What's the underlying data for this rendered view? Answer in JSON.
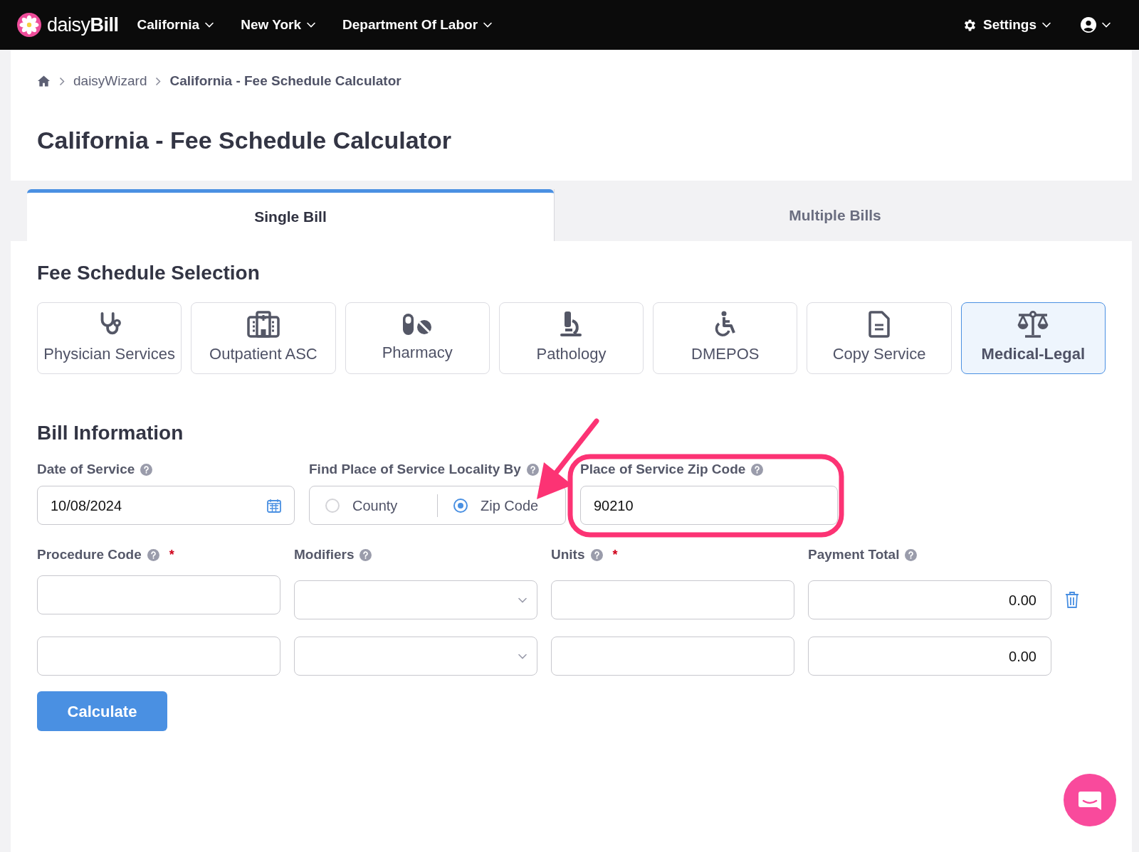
{
  "nav": {
    "logo": "daisy**Bill**",
    "menus": [
      "California",
      "New York",
      "Department Of Labor"
    ],
    "settings": "Settings"
  },
  "breadcrumb": [
    "daisyWizard",
    "California - Fee Schedule Calculator"
  ],
  "title": "California - Fee Schedule Calculator",
  "tabs": [
    {
      "label": "Single Bill",
      "selected": true
    },
    {
      "label": "Multiple Bills",
      "selected": false
    }
  ],
  "fee_schedule": {
    "heading": "Fee Schedule Selection",
    "options": [
      {
        "label": "Physician Services",
        "selected": false
      },
      {
        "label": "Outpatient ASC",
        "selected": false
      },
      {
        "label": "Pharmacy",
        "selected": false
      },
      {
        "label": "Pathology",
        "selected": false
      },
      {
        "label": "DMEPOS",
        "selected": false
      },
      {
        "label": "Copy Service",
        "selected": false
      },
      {
        "label": "Medical-Legal",
        "selected": true
      }
    ]
  },
  "bill_information": {
    "heading": "Bill Information",
    "date_of_service": {
      "label": "Date of Service",
      "value": "10/08/2024"
    },
    "locality": {
      "label": "Find Place of Service Locality By",
      "options": [
        {
          "label": "County",
          "selected": false
        },
        {
          "label": "Zip Code",
          "selected": true
        }
      ]
    },
    "zip_code": {
      "label": "Place of Service Zip Code",
      "value": "90210"
    },
    "line_columns": [
      {
        "label": "Procedure Code",
        "required": true,
        "kind": "text"
      },
      {
        "label": "Modifiers",
        "required": false,
        "kind": "select"
      },
      {
        "label": "Units",
        "required": true,
        "kind": "text"
      },
      {
        "label": "Payment Total",
        "required": false,
        "kind": "total"
      }
    ],
    "line_rows": [
      {
        "payment_total": "0.00",
        "deletable": true
      },
      {
        "payment_total": "0.00",
        "deletable": false
      }
    ],
    "required_mark": "*",
    "button": "Calculate"
  }
}
